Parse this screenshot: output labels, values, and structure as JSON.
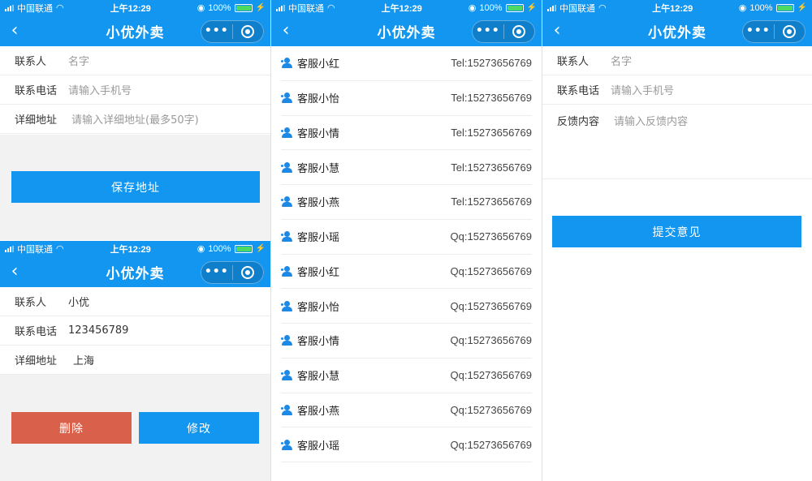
{
  "status": {
    "carrier": "中国联通",
    "time": "上午12:29",
    "battery": "100%",
    "bolt": "⚡"
  },
  "nav": {
    "title": "小优外卖",
    "back": "‹",
    "more": "•••"
  },
  "address_form": {
    "fields": [
      {
        "label": "联系人",
        "placeholder": "名字"
      },
      {
        "label": "联系电话",
        "placeholder": "请输入手机号"
      },
      {
        "label": "详细地址",
        "placeholder": "请输入详细地址(最多50字)"
      }
    ],
    "save_label": "保存地址"
  },
  "edit_form": {
    "fields": [
      {
        "label": "联系人",
        "value": "小优"
      },
      {
        "label": "联系电话",
        "value": "123456789"
      },
      {
        "label": "详细地址",
        "value": "上海"
      }
    ],
    "delete_label": "删除",
    "modify_label": "修改"
  },
  "service_list": [
    {
      "name": "客服小红",
      "contact": "Tel:15273656769"
    },
    {
      "name": "客服小怡",
      "contact": "Tel:15273656769"
    },
    {
      "name": "客服小情",
      "contact": "Tel:15273656769"
    },
    {
      "name": "客服小慧",
      "contact": "Tel:15273656769"
    },
    {
      "name": "客服小燕",
      "contact": "Tel:15273656769"
    },
    {
      "name": "客服小瑶",
      "contact": "Qq:15273656769"
    },
    {
      "name": "客服小红",
      "contact": "Qq:15273656769"
    },
    {
      "name": "客服小怡",
      "contact": "Qq:15273656769"
    },
    {
      "name": "客服小情",
      "contact": "Qq:15273656769"
    },
    {
      "name": "客服小慧",
      "contact": "Qq:15273656769"
    },
    {
      "name": "客服小燕",
      "contact": "Qq:15273656769"
    },
    {
      "name": "客服小瑶",
      "contact": "Qq:15273656769"
    }
  ],
  "feedback_form": {
    "fields": [
      {
        "label": "联系人",
        "placeholder": "名字"
      },
      {
        "label": "联系电话",
        "placeholder": "请输入手机号"
      },
      {
        "label": "反馈内容",
        "placeholder": "请输入反馈内容"
      }
    ],
    "submit_label": "提交意见"
  },
  "colors": {
    "primary": "#1296f0",
    "danger": "#d9614b",
    "background": "#f2f2f2"
  }
}
